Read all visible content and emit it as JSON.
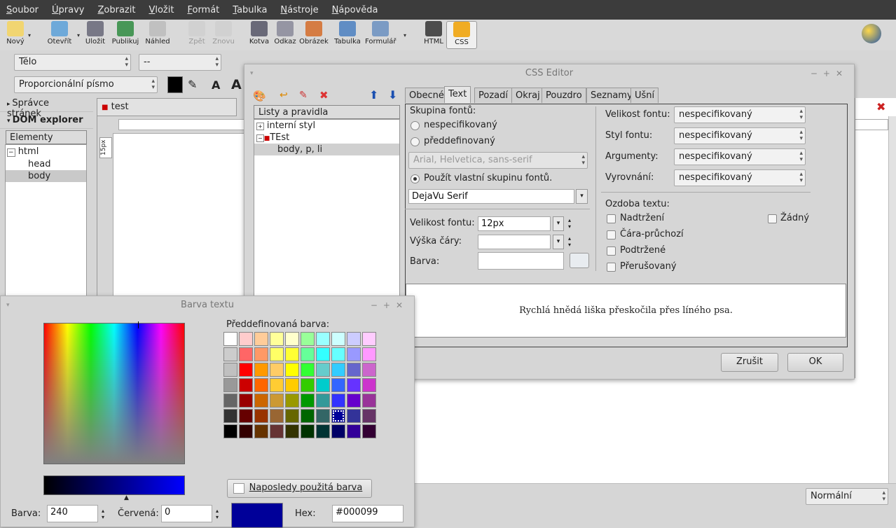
{
  "menu": [
    "Soubor",
    "Úpravy",
    "Zobrazit",
    "Vložit",
    "Formát",
    "Tabulka",
    "Nástroje",
    "Nápověda"
  ],
  "toolbar": {
    "buttons": [
      {
        "label": "Nový",
        "icon": "new-document-icon",
        "enabled": true
      },
      {
        "label": "Otevřít",
        "icon": "open-folder-icon",
        "enabled": true
      },
      {
        "label": "Uložit",
        "icon": "save-disk-icon",
        "enabled": true
      },
      {
        "label": "Publikuj",
        "icon": "publish-globe-icon",
        "enabled": true
      },
      {
        "label": "Náhled",
        "icon": "preview-magnifier-icon",
        "enabled": true
      },
      {
        "label": "Zpět",
        "icon": "undo-icon",
        "enabled": false
      },
      {
        "label": "Znovu",
        "icon": "redo-icon",
        "enabled": false
      },
      {
        "label": "Kotva",
        "icon": "anchor-icon",
        "enabled": true
      },
      {
        "label": "Odkaz",
        "icon": "link-chain-icon",
        "enabled": true
      },
      {
        "label": "Obrázek",
        "icon": "image-icon",
        "enabled": true
      },
      {
        "label": "Tabulka",
        "icon": "table-icon",
        "enabled": true
      },
      {
        "label": "Formulář",
        "icon": "form-icon",
        "enabled": true
      },
      {
        "label": "HTML",
        "icon": "html-tag-icon",
        "enabled": true
      },
      {
        "label": "CSS",
        "icon": "css-icon",
        "enabled": true
      }
    ]
  },
  "format": {
    "paragraph": "Tělo",
    "style": "--",
    "font": "Proporcionální písmo"
  },
  "sidebar": {
    "sections": [
      "Správce stránek",
      "DOM explorer"
    ],
    "tree_header": "Elementy",
    "tree": [
      {
        "label": "html",
        "level": 0
      },
      {
        "label": "head",
        "level": 1
      },
      {
        "label": "body",
        "level": 1
      }
    ]
  },
  "document": {
    "tab": "test",
    "ruler": "15px",
    "status_mode": "Normální"
  },
  "css_editor": {
    "title": "CSS Editor",
    "rules_header": "Listy a pravidla",
    "rules": [
      {
        "label": "interní styl",
        "level": 0
      },
      {
        "label": "TEst",
        "level": 0
      },
      {
        "label": "body, p, li",
        "level": 1
      }
    ],
    "tabs": [
      "Obecné",
      "Text",
      "Pozadí",
      "Okraj",
      "Pouzdro",
      "Seznamy",
      "Ušní"
    ],
    "active_tab": "Text",
    "font_group_label": "Skupina fontů:",
    "radio_unspecified": "nespecifikovaný",
    "radio_predefined": "předdefinovaný",
    "predefined_value": "Arial, Helvetica, sans-serif",
    "radio_custom": "Použít vlastní skupinu fontů.",
    "custom_value": "DejaVu Serif",
    "size_label": "Velikost fontu:",
    "size_value": "12px",
    "line_label": "Výška čáry:",
    "line_value": "",
    "color_label": "Barva:",
    "right": {
      "size": "Velikost fontu:",
      "style": "Styl fontu:",
      "args": "Argumenty:",
      "align": "Vyrovnání:",
      "value": "nespecifikovaný"
    },
    "decoration_label": "Ozdoba textu:",
    "decorations": [
      "Nadtržení",
      "Čára-průchozí",
      "Podtržené",
      "Přerušovaný"
    ],
    "none_label": "Žádný",
    "preview": "Rychlá hnědá liška přeskočila přes líného psa.",
    "cancel": "Zrušit",
    "ok": "OK"
  },
  "color_dialog": {
    "title": "Barva textu",
    "predefined_label": "Předdefinovaná barva:",
    "last_used": "Naposledy použitá barva",
    "hue_label": "Barva:",
    "hue_value": "240",
    "red_label": "Červená:",
    "red_value": "0",
    "hex_label": "Hex:",
    "hex_value": "#000099",
    "current_color": "#000099",
    "palette": [
      [
        "#ffffff",
        "#ffcccc",
        "#ffcc99",
        "#ffff99",
        "#ffffcc",
        "#99ff99",
        "#99ffff",
        "#ccffff",
        "#ccccff",
        "#ffccff"
      ],
      [
        "#cccccc",
        "#ff6666",
        "#ff9966",
        "#ffff66",
        "#ffff33",
        "#66ff99",
        "#33ffff",
        "#66ffff",
        "#9999ff",
        "#ff99ff"
      ],
      [
        "#c0c0c0",
        "#ff0000",
        "#ff9900",
        "#ffcc66",
        "#ffff00",
        "#33ff33",
        "#66cccc",
        "#33ccff",
        "#6666cc",
        "#cc66cc"
      ],
      [
        "#999999",
        "#cc0000",
        "#ff6600",
        "#ffcc33",
        "#ffcc00",
        "#33cc00",
        "#00cccc",
        "#3366ff",
        "#6633ff",
        "#cc33cc"
      ],
      [
        "#666666",
        "#990000",
        "#cc6600",
        "#cc9933",
        "#999900",
        "#009900",
        "#339999",
        "#3333ff",
        "#6600cc",
        "#993399"
      ],
      [
        "#333333",
        "#660000",
        "#993300",
        "#996633",
        "#666600",
        "#006600",
        "#336666",
        "#000099",
        "#333399",
        "#663366"
      ],
      [
        "#000000",
        "#330000",
        "#663300",
        "#663333",
        "#333300",
        "#003300",
        "#003333",
        "#000066",
        "#330099",
        "#330033"
      ]
    ],
    "selected": "#000099"
  }
}
